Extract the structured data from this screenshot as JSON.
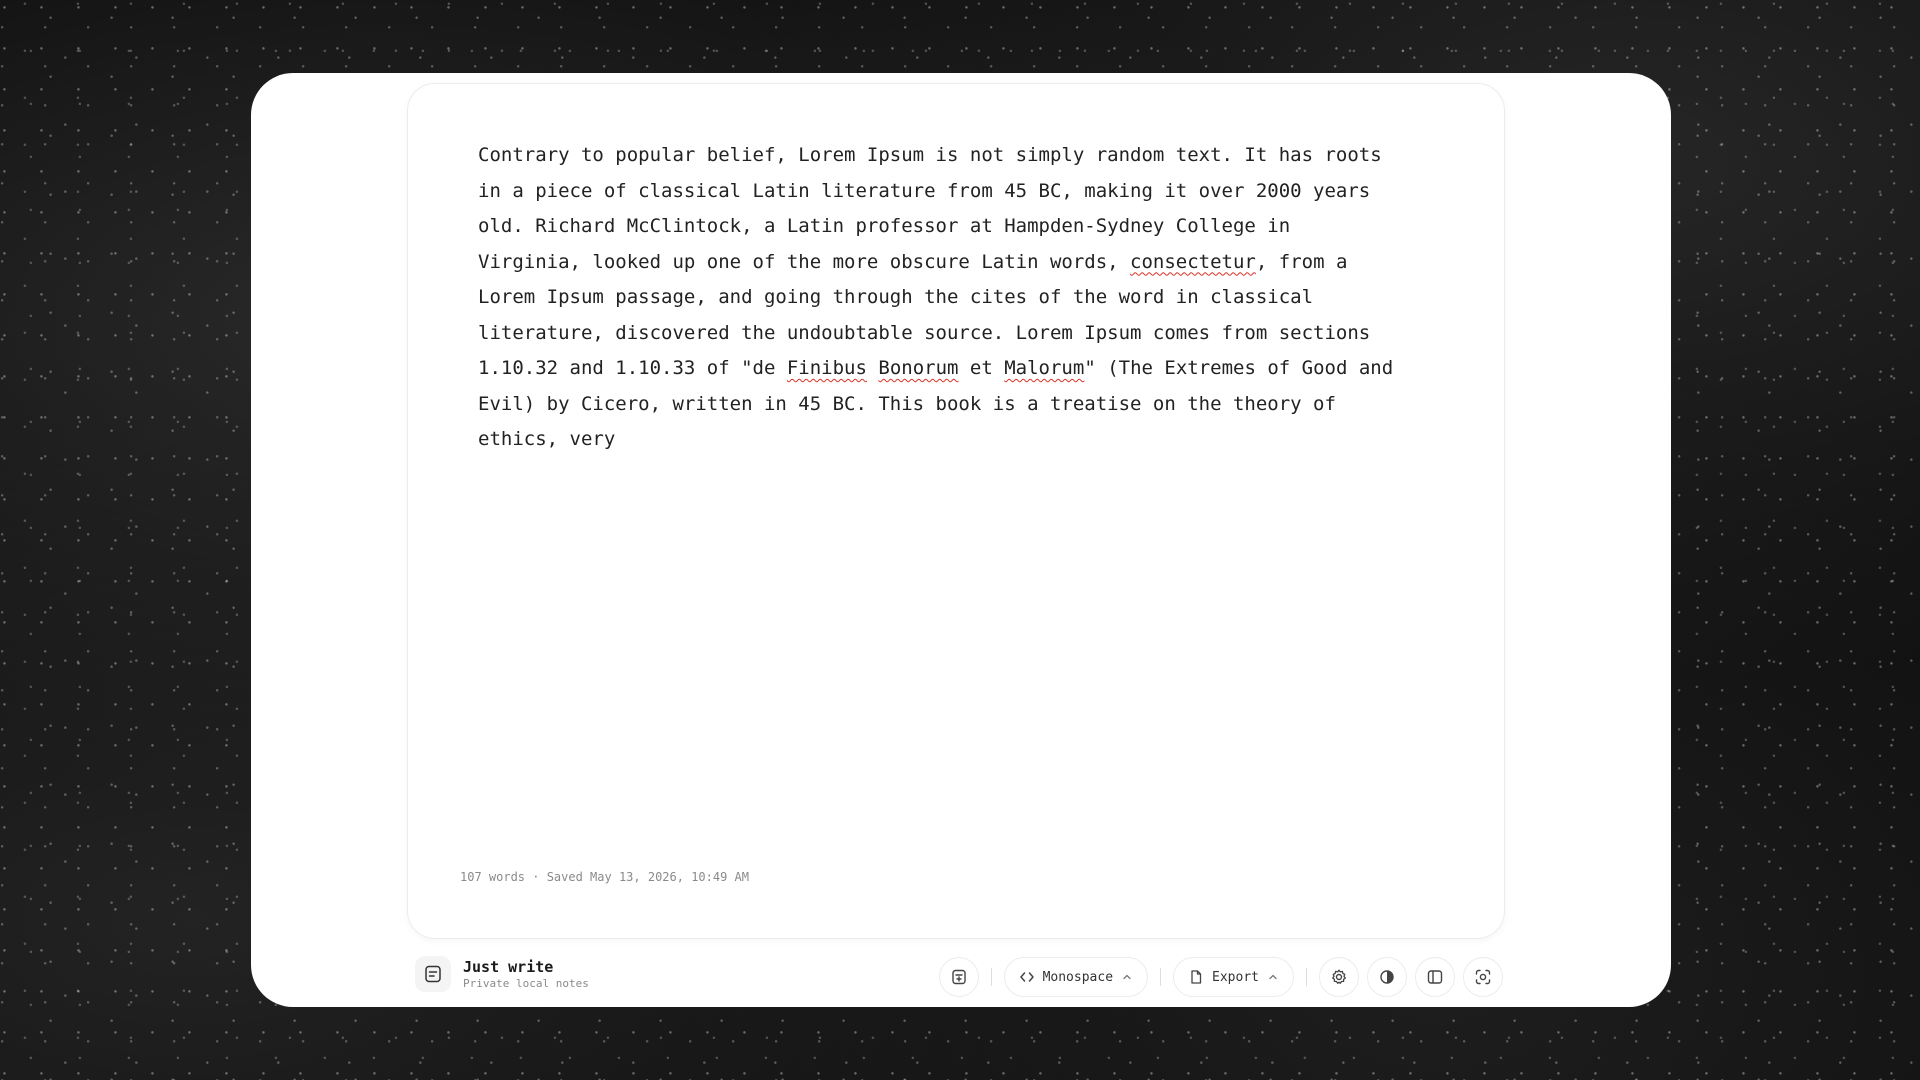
{
  "editor": {
    "segments": [
      {
        "text": "Contrary to popular belief, Lorem Ipsum is not simply random text. It has roots\nin a piece of classical Latin literature from 45 BC, making it over 2000 years\nold. Richard McClintock, a Latin professor at Hampden-Sydney College in\nVirginia, looked up one of the more obscure Latin words, ",
        "misspelled": false
      },
      {
        "text": "consectetur",
        "misspelled": true
      },
      {
        "text": ", from a\nLorem Ipsum passage, and going through the cites of the word in classical\nliterature, discovered the undoubtable source. Lorem Ipsum comes from sections\n1.10.32 and 1.10.33 of \"de ",
        "misspelled": false
      },
      {
        "text": "Finibus",
        "misspelled": true
      },
      {
        "text": " ",
        "misspelled": false
      },
      {
        "text": "Bonorum",
        "misspelled": true
      },
      {
        "text": " et ",
        "misspelled": false
      },
      {
        "text": "Malorum",
        "misspelled": true
      },
      {
        "text": "\" (The Extremes of Good and\nEvil) by Cicero, written in 45 BC. This book is a treatise on the theory of\nethics, very",
        "misspelled": false
      }
    ],
    "status": "107 words · Saved May 13, 2026, 10:49 AM"
  },
  "brand": {
    "title": "Just write",
    "subtitle": "Private local notes",
    "icon": "note-icon"
  },
  "toolbar": {
    "new_note_icon": "new-note-icon",
    "font_label": "Monospace",
    "font_icon": "code-icon",
    "export_label": "Export",
    "export_icon": "file-icon",
    "settings_icon": "gear-icon",
    "theme_icon": "contrast-icon",
    "sidebar_icon": "sidebar-icon",
    "focus_icon": "focus-icon"
  }
}
